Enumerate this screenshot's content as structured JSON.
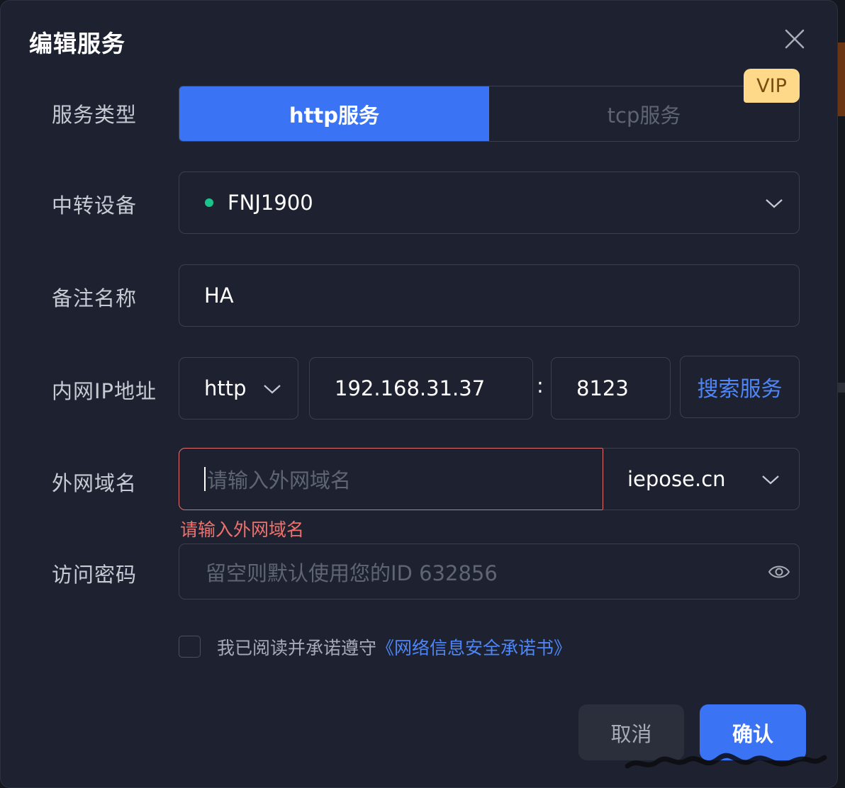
{
  "dialog": {
    "title": "编辑服务"
  },
  "service_type": {
    "label": "服务类型",
    "options": [
      "http服务",
      "tcp服务"
    ],
    "selected": "http服务",
    "vip_badge": "VIP"
  },
  "relay_device": {
    "label": "中转设备",
    "value": "FNJ1900",
    "status_color": "#19c58a"
  },
  "remark_name": {
    "label": "备注名称",
    "value": "HA"
  },
  "lan_address": {
    "label": "内网IP地址",
    "protocol": "http",
    "ip": "192.168.31.37",
    "separator": ":",
    "port": "8123",
    "search_button": "搜索服务"
  },
  "public_domain": {
    "label": "外网域名",
    "placeholder": "请输入外网域名",
    "suffix": "iepose.cn",
    "error": "请输入外网域名"
  },
  "access_password": {
    "label": "访问密码",
    "placeholder": "留空则默认使用您的ID 632856"
  },
  "agreement": {
    "text": "我已阅读并承诺遵守",
    "link": "《网络信息安全承诺书》",
    "checked": false
  },
  "buttons": {
    "cancel": "取消",
    "confirm": "确认"
  },
  "colors": {
    "primary": "#3b73f5",
    "error": "#f0716c",
    "link": "#4e86f7",
    "background": "#1e2230"
  }
}
